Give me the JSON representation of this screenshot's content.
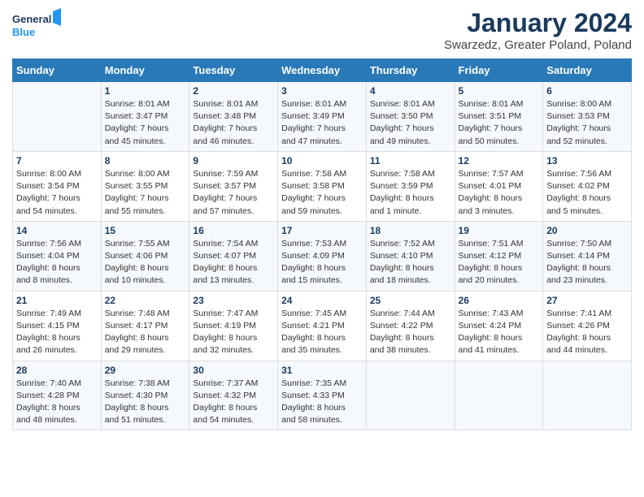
{
  "header": {
    "logo_line1": "General",
    "logo_line2": "Blue",
    "title": "January 2024",
    "subtitle": "Swarzedz, Greater Poland, Poland"
  },
  "days_of_week": [
    "Sunday",
    "Monday",
    "Tuesday",
    "Wednesday",
    "Thursday",
    "Friday",
    "Saturday"
  ],
  "weeks": [
    [
      {
        "day": "",
        "content": ""
      },
      {
        "day": "1",
        "content": "Sunrise: 8:01 AM\nSunset: 3:47 PM\nDaylight: 7 hours\nand 45 minutes."
      },
      {
        "day": "2",
        "content": "Sunrise: 8:01 AM\nSunset: 3:48 PM\nDaylight: 7 hours\nand 46 minutes."
      },
      {
        "day": "3",
        "content": "Sunrise: 8:01 AM\nSunset: 3:49 PM\nDaylight: 7 hours\nand 47 minutes."
      },
      {
        "day": "4",
        "content": "Sunrise: 8:01 AM\nSunset: 3:50 PM\nDaylight: 7 hours\nand 49 minutes."
      },
      {
        "day": "5",
        "content": "Sunrise: 8:01 AM\nSunset: 3:51 PM\nDaylight: 7 hours\nand 50 minutes."
      },
      {
        "day": "6",
        "content": "Sunrise: 8:00 AM\nSunset: 3:53 PM\nDaylight: 7 hours\nand 52 minutes."
      }
    ],
    [
      {
        "day": "7",
        "content": "Sunrise: 8:00 AM\nSunset: 3:54 PM\nDaylight: 7 hours\nand 54 minutes."
      },
      {
        "day": "8",
        "content": "Sunrise: 8:00 AM\nSunset: 3:55 PM\nDaylight: 7 hours\nand 55 minutes."
      },
      {
        "day": "9",
        "content": "Sunrise: 7:59 AM\nSunset: 3:57 PM\nDaylight: 7 hours\nand 57 minutes."
      },
      {
        "day": "10",
        "content": "Sunrise: 7:58 AM\nSunset: 3:58 PM\nDaylight: 7 hours\nand 59 minutes."
      },
      {
        "day": "11",
        "content": "Sunrise: 7:58 AM\nSunset: 3:59 PM\nDaylight: 8 hours\nand 1 minute."
      },
      {
        "day": "12",
        "content": "Sunrise: 7:57 AM\nSunset: 4:01 PM\nDaylight: 8 hours\nand 3 minutes."
      },
      {
        "day": "13",
        "content": "Sunrise: 7:56 AM\nSunset: 4:02 PM\nDaylight: 8 hours\nand 5 minutes."
      }
    ],
    [
      {
        "day": "14",
        "content": "Sunrise: 7:56 AM\nSunset: 4:04 PM\nDaylight: 8 hours\nand 8 minutes."
      },
      {
        "day": "15",
        "content": "Sunrise: 7:55 AM\nSunset: 4:06 PM\nDaylight: 8 hours\nand 10 minutes."
      },
      {
        "day": "16",
        "content": "Sunrise: 7:54 AM\nSunset: 4:07 PM\nDaylight: 8 hours\nand 13 minutes."
      },
      {
        "day": "17",
        "content": "Sunrise: 7:53 AM\nSunset: 4:09 PM\nDaylight: 8 hours\nand 15 minutes."
      },
      {
        "day": "18",
        "content": "Sunrise: 7:52 AM\nSunset: 4:10 PM\nDaylight: 8 hours\nand 18 minutes."
      },
      {
        "day": "19",
        "content": "Sunrise: 7:51 AM\nSunset: 4:12 PM\nDaylight: 8 hours\nand 20 minutes."
      },
      {
        "day": "20",
        "content": "Sunrise: 7:50 AM\nSunset: 4:14 PM\nDaylight: 8 hours\nand 23 minutes."
      }
    ],
    [
      {
        "day": "21",
        "content": "Sunrise: 7:49 AM\nSunset: 4:15 PM\nDaylight: 8 hours\nand 26 minutes."
      },
      {
        "day": "22",
        "content": "Sunrise: 7:48 AM\nSunset: 4:17 PM\nDaylight: 8 hours\nand 29 minutes."
      },
      {
        "day": "23",
        "content": "Sunrise: 7:47 AM\nSunset: 4:19 PM\nDaylight: 8 hours\nand 32 minutes."
      },
      {
        "day": "24",
        "content": "Sunrise: 7:45 AM\nSunset: 4:21 PM\nDaylight: 8 hours\nand 35 minutes."
      },
      {
        "day": "25",
        "content": "Sunrise: 7:44 AM\nSunset: 4:22 PM\nDaylight: 8 hours\nand 38 minutes."
      },
      {
        "day": "26",
        "content": "Sunrise: 7:43 AM\nSunset: 4:24 PM\nDaylight: 8 hours\nand 41 minutes."
      },
      {
        "day": "27",
        "content": "Sunrise: 7:41 AM\nSunset: 4:26 PM\nDaylight: 8 hours\nand 44 minutes."
      }
    ],
    [
      {
        "day": "28",
        "content": "Sunrise: 7:40 AM\nSunset: 4:28 PM\nDaylight: 8 hours\nand 48 minutes."
      },
      {
        "day": "29",
        "content": "Sunrise: 7:38 AM\nSunset: 4:30 PM\nDaylight: 8 hours\nand 51 minutes."
      },
      {
        "day": "30",
        "content": "Sunrise: 7:37 AM\nSunset: 4:32 PM\nDaylight: 8 hours\nand 54 minutes."
      },
      {
        "day": "31",
        "content": "Sunrise: 7:35 AM\nSunset: 4:33 PM\nDaylight: 8 hours\nand 58 minutes."
      },
      {
        "day": "",
        "content": ""
      },
      {
        "day": "",
        "content": ""
      },
      {
        "day": "",
        "content": ""
      }
    ]
  ]
}
